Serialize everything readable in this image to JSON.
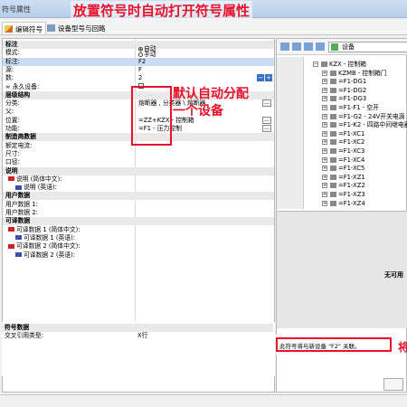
{
  "window": {
    "title": "符号属性"
  },
  "banner": "放置符号时自动打开符号属性",
  "tabs": [
    {
      "label": "编辑符号",
      "active": true
    },
    {
      "label": "设备型号与回路",
      "active": false
    }
  ],
  "annotation": {
    "text_line1": "默认自动分配",
    "text_line2": "一个设备"
  },
  "properties": [
    {
      "label": "标注",
      "value": "",
      "type": "section"
    },
    {
      "label": "模式:",
      "value": "",
      "type": "mode"
    },
    {
      "label": "标注:",
      "value": "F2",
      "type": "selected"
    },
    {
      "label": "源:",
      "value": "F",
      "type": "field"
    },
    {
      "label": "数:",
      "value": "2",
      "type": "field"
    },
    {
      "label": "∞ 永久设备:",
      "value": "",
      "type": "checkbox"
    },
    {
      "label": "层级结构",
      "value": "",
      "type": "section"
    },
    {
      "label": "分类:",
      "value": "熔断器 , 分类器 \\ 熔断器",
      "type": "ellipsis"
    },
    {
      "label": "父:",
      "value": "",
      "type": "field"
    },
    {
      "label": "位置:",
      "value": "=ZZ+KZX - 控制箱",
      "type": "ellipsis"
    },
    {
      "label": "功能:",
      "value": "=F1 - 压力控制",
      "type": "ellipsis"
    },
    {
      "label": "制造商数据",
      "value": "",
      "type": "section"
    },
    {
      "label": "额定电流:",
      "value": "",
      "type": "field"
    },
    {
      "label": "尺寸:",
      "value": "",
      "type": "field"
    },
    {
      "label": "口径:",
      "value": "",
      "type": "field"
    },
    {
      "label": "说明",
      "value": "",
      "type": "section"
    },
    {
      "label": "说明 (简体中文):",
      "value": "",
      "type": "flag-cn"
    },
    {
      "label": "说明 (英语):",
      "value": "",
      "type": "flag-uk"
    },
    {
      "label": "用户数据",
      "value": "",
      "type": "section"
    },
    {
      "label": "用户数据 1:",
      "value": "",
      "type": "field"
    },
    {
      "label": "用户数据 2:",
      "value": "",
      "type": "field"
    },
    {
      "label": "可译数据",
      "value": "",
      "type": "section"
    },
    {
      "label": "可译数据 1 (简体中文):",
      "value": "",
      "type": "flag-cn"
    },
    {
      "label": "可译数据 1 (英语):",
      "value": "",
      "type": "flag-uk"
    },
    {
      "label": "可译数据 2 (简体中文):",
      "value": "",
      "type": "flag-cn"
    },
    {
      "label": "可译数据 2 (英语):",
      "value": "",
      "type": "flag-uk"
    }
  ],
  "mode_options": {
    "auto": "自动",
    "manual": "手动"
  },
  "symbol_data": [
    {
      "label": "符号数据",
      "value": "",
      "type": "section"
    },
    {
      "label": "交叉引用类型:",
      "value": "X行",
      "type": "field"
    }
  ],
  "right_panel": {
    "combo": "设备",
    "tree": [
      {
        "label": "KZX - 控制箱",
        "level": 0,
        "expanded": true
      },
      {
        "label": "KZMB - 控制箱门",
        "level": 1,
        "expanded": false
      },
      {
        "label": "=F1-DG1",
        "level": 1
      },
      {
        "label": "=F1-DG2",
        "level": 1
      },
      {
        "label": "=F1-DG3",
        "level": 1
      },
      {
        "label": "=F1-F1 - 空开",
        "level": 1
      },
      {
        "label": "=F1-G2 - 24V开关电源",
        "level": 1
      },
      {
        "label": "=F1-K2 - 四路中间继电器",
        "level": 1
      },
      {
        "label": "=F1-XC1",
        "level": 1
      },
      {
        "label": "=F1-XC2",
        "level": 1
      },
      {
        "label": "=F1-XC3",
        "level": 1
      },
      {
        "label": "=F1-XC4",
        "level": 1
      },
      {
        "label": "=F1-XC5",
        "level": 1
      },
      {
        "label": "=F1-XZ1",
        "level": 1
      },
      {
        "label": "=F1-XZ2",
        "level": 1
      },
      {
        "label": "=F1-XZ3",
        "level": 1
      },
      {
        "label": "=F1-XZ4",
        "level": 1
      }
    ],
    "preview_text": "无可用"
  },
  "status": {
    "message": "此符号将与新设备 \"F2\" 关联。",
    "extra": "将"
  }
}
